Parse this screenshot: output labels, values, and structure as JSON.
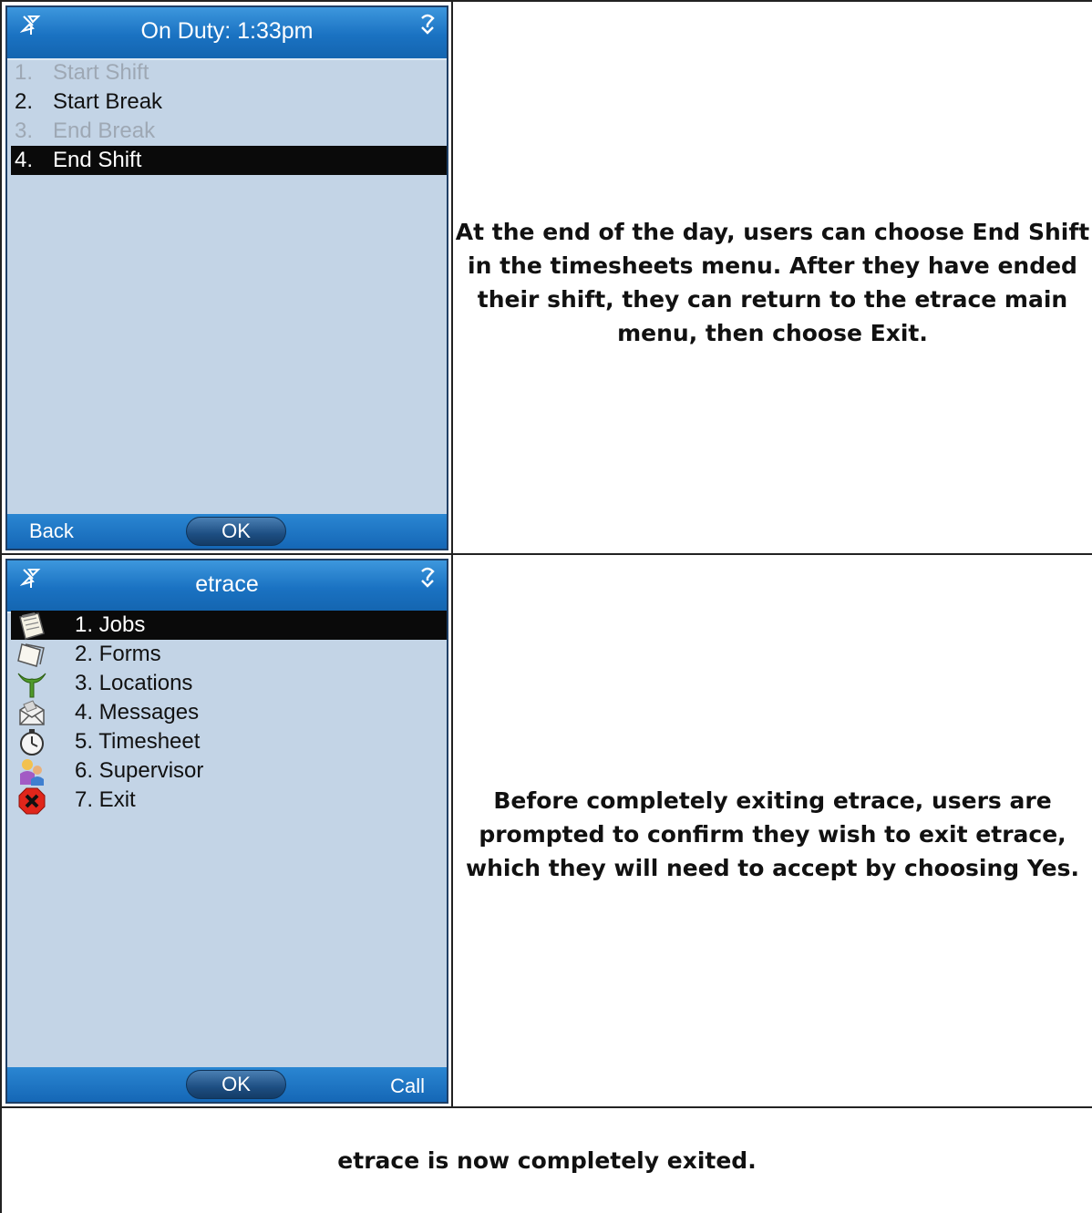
{
  "screen1": {
    "title": "On Duty: 1:33pm",
    "items": [
      {
        "num": "1.",
        "label": "Start Shift",
        "state": "disabled"
      },
      {
        "num": "2.",
        "label": "Start Break",
        "state": "normal"
      },
      {
        "num": "3.",
        "label": "End Break",
        "state": "disabled"
      },
      {
        "num": "4.",
        "label": "End Shift",
        "state": "selected"
      }
    ],
    "softkeys": {
      "left": "Back",
      "center": "OK"
    }
  },
  "screen2": {
    "title": "etrace",
    "items": [
      {
        "label": "1. Jobs",
        "icon": "jobs-icon",
        "state": "selected"
      },
      {
        "label": "2. Forms",
        "icon": "forms-icon",
        "state": "normal"
      },
      {
        "label": "3. Locations",
        "icon": "locations-icon",
        "state": "normal"
      },
      {
        "label": "4. Messages",
        "icon": "messages-icon",
        "state": "normal"
      },
      {
        "label": "5. Timesheet",
        "icon": "timesheet-icon",
        "state": "normal"
      },
      {
        "label": "6. Supervisor",
        "icon": "supervisor-icon",
        "state": "normal"
      },
      {
        "label": "7. Exit",
        "icon": "exit-icon",
        "state": "normal"
      }
    ],
    "softkeys": {
      "center": "OK",
      "right": "Call"
    }
  },
  "descriptions": {
    "step1": "At the end of the day, users can choose End Shift in the timesheets menu. After they have ended their shift, they can return to the etrace main menu, then choose Exit.",
    "step2": "Before completely exiting etrace, users are prompted to confirm they wish to exit etrace, which they will need to accept by choosing Yes.",
    "step3": "etrace is now completely exited."
  },
  "colors": {
    "titlebar": "#1a72c2",
    "screen_bg": "#c3d4e6",
    "selection": "#0a0a0a",
    "disabled_text": "#9ea8b4"
  }
}
